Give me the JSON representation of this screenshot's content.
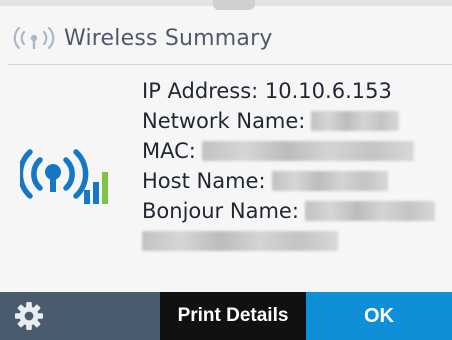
{
  "header": {
    "title": "Wireless Summary",
    "icon": "wireless-signal-icon"
  },
  "details": {
    "ip_label": "IP Address: 10.10.6.153",
    "network_name_label": "Network Name:",
    "mac_label": "MAC:",
    "host_name_label": "Host Name:",
    "bonjour_name_label": "Bonjour Name:"
  },
  "status_icon": "wireless-connected-icon",
  "footer": {
    "settings_icon": "gear-icon",
    "print_details_label": "Print Details",
    "ok_label": "OK"
  },
  "colors": {
    "footer_background": "#4b5b6e",
    "print_button": "#111111",
    "ok_button": "#0f8fd8",
    "wireless_blue": "#1578c6",
    "signal_green": "#7fc34a"
  }
}
